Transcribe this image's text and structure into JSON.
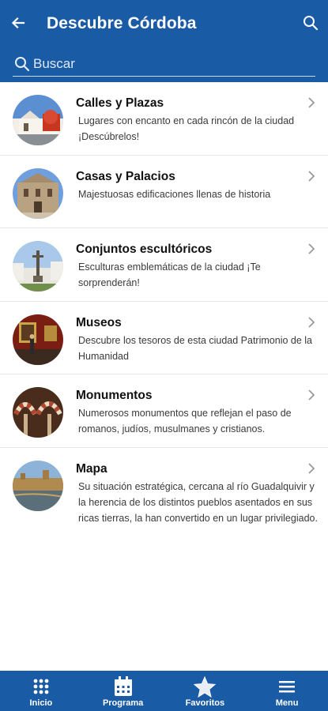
{
  "header": {
    "title": "Descubre Córdoba",
    "back_icon": "arrow-left-icon",
    "search_icon": "search-icon",
    "bg_color": "#1a5ba6"
  },
  "search": {
    "placeholder": "Buscar",
    "value": ""
  },
  "items": [
    {
      "title": "Calles y Plazas",
      "description": "Lugares con encanto en cada rincón de la ciudad ¡Descúbrelos!"
    },
    {
      "title": "Casas y Palacios",
      "description": "Majestuosas edificaciones llenas de historia"
    },
    {
      "title": "Conjuntos escultóricos",
      "description": "Esculturas emblemáticas de la ciudad ¡Te sorprenderán!"
    },
    {
      "title": "Museos",
      "description": "Descubre los tesoros de esta ciudad Patrimonio de la Humanidad"
    },
    {
      "title": "Monumentos",
      "description": "Numerosos monumentos que reflejan el paso de romanos, judíos, musulmanes y cristianos."
    },
    {
      "title": "Mapa",
      "description": "Su situación estratégica, cercana al río Guadalquivir y la herencia de los distintos pueblos asentados en sus ricas tierras, la han convertido en un lugar privilegiado."
    }
  ],
  "bottom_nav": [
    {
      "label": "Inicio",
      "icon": "grid-icon"
    },
    {
      "label": "Programa",
      "icon": "calendar-icon"
    },
    {
      "label": "Favoritos",
      "icon": "star-icon"
    },
    {
      "label": "Menu",
      "icon": "hamburger-menu-icon"
    }
  ]
}
